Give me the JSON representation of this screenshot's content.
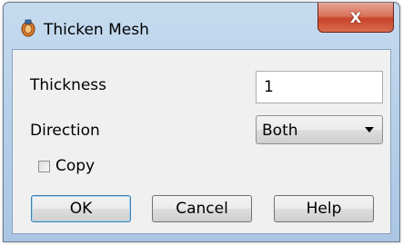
{
  "window": {
    "title": "Thicken Mesh",
    "close_label": "X"
  },
  "form": {
    "thickness_label": "Thickness",
    "thickness_value": "1",
    "direction_label": "Direction",
    "direction_selected": "Both",
    "copy_label": "Copy",
    "copy_checked": false
  },
  "buttons": {
    "ok": "OK",
    "cancel": "Cancel",
    "help": "Help"
  },
  "icons": {
    "app": "thicken-mesh-app-icon",
    "dropdown": "chevron-down-icon"
  }
}
